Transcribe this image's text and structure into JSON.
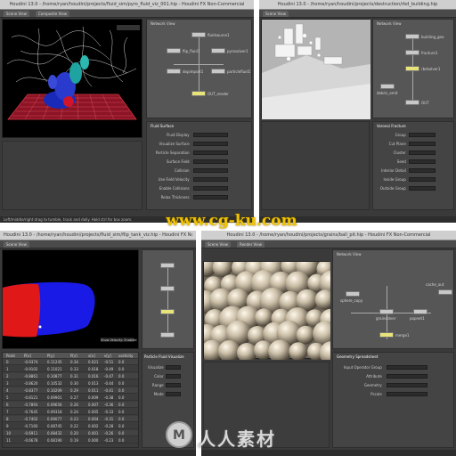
{
  "quad1": {
    "title": "Houdini 13.0 - /home/ryan/houdini/projects/fluid_sim/pyro_fluid_viz_001.hip - Houdini FX Non-Commercial",
    "tabs": [
      "Scene View",
      "Composite View"
    ],
    "net_tabs": [
      "Network View",
      "Material Palette"
    ],
    "nodes": [
      "fluidsource1",
      "flip_fluid1",
      "pyrosolver1",
      "dopimport1",
      "particlefluid1",
      "OUT_render"
    ],
    "params_title": "Fluid Surface",
    "param_labels": [
      "Fluid Display",
      "Visualize Surface",
      "Particle Separation",
      "Surface Field",
      "Collision",
      "Use Field Velocity",
      "Enable Collisions",
      "Relax Thickness"
    ],
    "status": "Left/middle/right drag to tumble, track and dolly. Hold ctrl for box zoom."
  },
  "quad2": {
    "title": "Houdini 13.0 - /home/ryan/houdini/projects/destruction/rbd_building.hip",
    "tabs": [
      "Scene View"
    ],
    "net_tabs": [
      "Network View"
    ],
    "nodes": [
      "building_geo",
      "fracture1",
      "rbdsolver1",
      "debris_emit",
      "OUT"
    ],
    "params_title": "Voronoi Fracture",
    "param_labels": [
      "Group",
      "Cut Plane",
      "Cluster",
      "Seed",
      "Interior Detail",
      "Inside Group",
      "Outside Group"
    ]
  },
  "quad3": {
    "title": "Houdini 13.0 - /home/ryan/houdini/projects/fluid_sim/flip_tank_viz.hip - Houdini FX Non-Commercial",
    "tabs": [
      "Scene View"
    ],
    "status": "Show Velocity: Enabled",
    "sheet_header": [
      "Point",
      "P[x]",
      "P[y]",
      "P[z]",
      "v[x]",
      "v[y]",
      "vorticity"
    ],
    "sheet_rows": [
      [
        "0",
        "-0.9374",
        "0.11245",
        "0.34",
        "0.021",
        "-0.51",
        "0.0"
      ],
      [
        "1",
        "-0.9102",
        "0.11021",
        "0.33",
        "0.018",
        "-0.49",
        "0.0"
      ],
      [
        "2",
        "-0.8861",
        "0.10877",
        "0.31",
        "0.016",
        "-0.47",
        "0.0"
      ],
      [
        "3",
        "-0.8620",
        "0.10532",
        "0.30",
        "0.013",
        "-0.44",
        "0.0"
      ],
      [
        "4",
        "-0.8377",
        "0.10209",
        "0.29",
        "0.011",
        "-0.41",
        "0.0"
      ],
      [
        "5",
        "-0.8121",
        "0.09901",
        "0.27",
        "0.009",
        "-0.38",
        "0.0"
      ],
      [
        "6",
        "-0.7893",
        "0.09656",
        "0.26",
        "0.007",
        "-0.36",
        "0.0"
      ],
      [
        "7",
        "-0.7645",
        "0.09318",
        "0.24",
        "0.005",
        "-0.33",
        "0.0"
      ],
      [
        "8",
        "-0.7402",
        "0.09077",
        "0.23",
        "0.004",
        "-0.31",
        "0.0"
      ],
      [
        "9",
        "-0.7160",
        "0.08745",
        "0.22",
        "0.002",
        "-0.28",
        "0.0"
      ],
      [
        "10",
        "-0.6911",
        "0.08432",
        "0.20",
        "0.001",
        "-0.26",
        "0.0"
      ],
      [
        "11",
        "-0.6678",
        "0.08190",
        "0.19",
        "0.000",
        "-0.23",
        "0.0"
      ]
    ],
    "params_title": "Particle Fluid Visualize",
    "param_labels": [
      "Visualize",
      "Color",
      "Range",
      "Mode"
    ]
  },
  "quad4": {
    "title": "Houdini 13.0 - /home/ryan/houdini/projects/grains/ball_pit.hip - Houdini FX Non-Commercial",
    "tabs": [
      "Scene View",
      "Render View"
    ],
    "net_tabs": [
      "Network View",
      "Parameters"
    ],
    "nodes": [
      "sphere_copy",
      "grainsolver",
      "popnet1",
      "merge1",
      "cache_out"
    ],
    "params_title": "Geometry Spreadsheet",
    "param_labels": [
      "Input Operator Group",
      "Attribute",
      "Geometry",
      "Pscale"
    ]
  },
  "watermark": {
    "url": "www.cg-ku.com",
    "logo_letter": "M",
    "cn_text": "人人素材"
  },
  "colors": {
    "ui_dark": "#3a3a3a",
    "node_selected": "#e8e47a",
    "grid_red": "#c8283a",
    "fluid_red": "#e01818",
    "fluid_blue": "#1a1ae6",
    "watermark_yellow": "#f2c400"
  }
}
